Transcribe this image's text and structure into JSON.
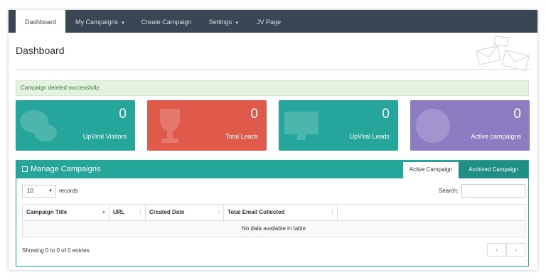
{
  "nav": {
    "dashboard": "Dashboard",
    "my_campaigns": "My Campaigns",
    "create_campaign": "Create Campaign",
    "settings": "Settings",
    "jv_page": "JV Page"
  },
  "page": {
    "title": "Dashboard"
  },
  "alert": {
    "message": "Campaign deleted successfully."
  },
  "stats": [
    {
      "value": "0",
      "label": "UpViral Visitors",
      "color": "#26a69a",
      "icon": "chat-bubbles-icon"
    },
    {
      "value": "0",
      "label": "Total Leads",
      "color": "#e05a4c",
      "icon": "trophy-icon"
    },
    {
      "value": "0",
      "label": "UpViral Leads",
      "color": "#26a69a",
      "icon": "monitor-icon"
    },
    {
      "value": "0",
      "label": "Active campaigns",
      "color": "#8e7cc3",
      "icon": "globe-icon"
    }
  ],
  "campaigns": {
    "title": "Manage Campaigns",
    "tabs": {
      "active": "Active Campaign",
      "archived": "Archived Campaign"
    },
    "length": {
      "value": "10",
      "label": "records"
    },
    "search": {
      "label": "Search:"
    },
    "columns": [
      "Campaign Title",
      "URL",
      "Created Date",
      "Total Email Collected"
    ],
    "empty": "No data available in table",
    "info": "Showing 0 to 0 of 0 entries",
    "pager": {
      "prev": "‹",
      "next": "›"
    }
  },
  "colors": {
    "nav": "#3b4654",
    "teal": "#26a69a",
    "red": "#e05a4c",
    "purple": "#8e7cc3",
    "alert_bg": "#e5f2df"
  }
}
